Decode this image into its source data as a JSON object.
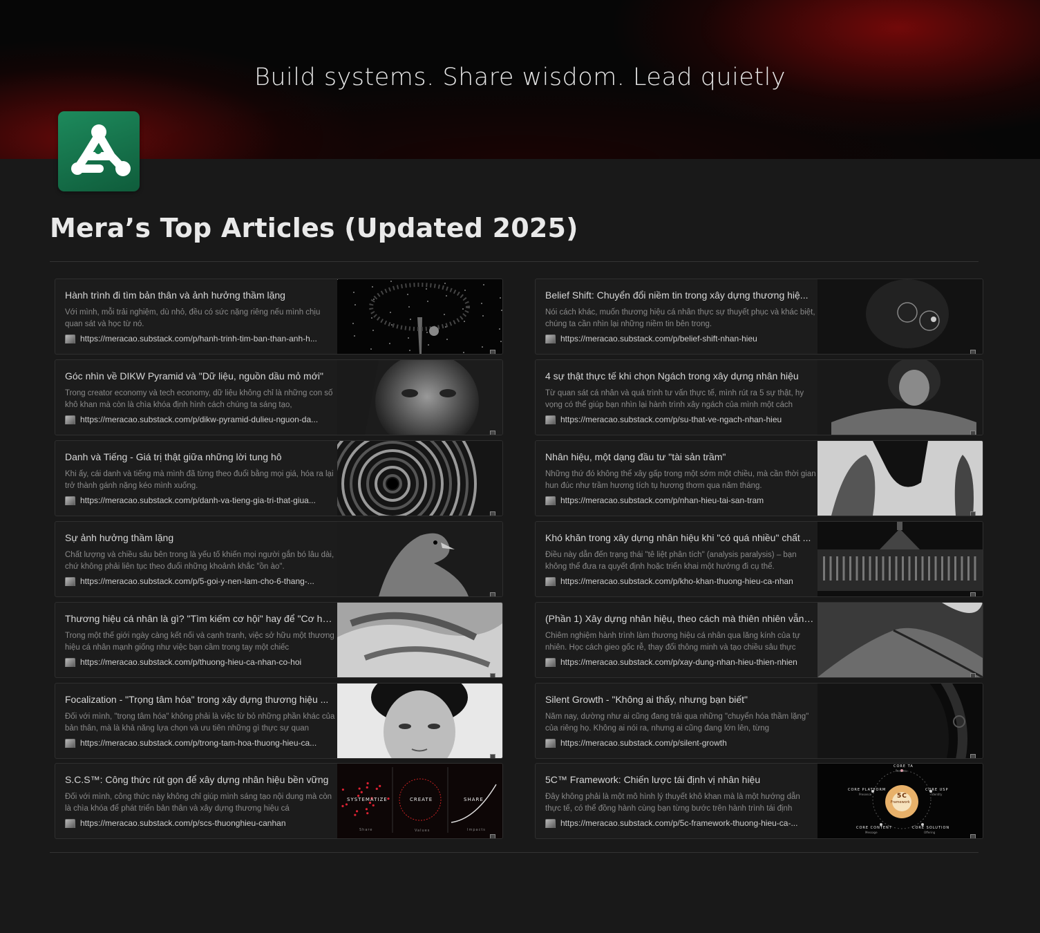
{
  "cover": {
    "tagline": "Build systems. Share wisdom. Lead quietly"
  },
  "page": {
    "title": "Mera’s Top Articles (Updated 2025)"
  },
  "colors": {
    "background": "#191919",
    "card_border": "#2f2f2f",
    "icon_green": "#1d8a5c",
    "cover_red": "#960a0a"
  },
  "left_cards": [
    {
      "title": "Hành trình đi tìm bản thân và ảnh hưởng thầm lặng",
      "desc": "Với mình, mỗi trải nghiệm, dù nhỏ, đều có sức nặng riêng nếu mình chịu quan sát và học từ nó.",
      "url": "https://meracao.substack.com/p/hanh-trinh-tim-ban-than-anh-h...",
      "thumb": "tree-night-thumbnail"
    },
    {
      "title": "Góc nhìn về DIKW Pyramid và \"Dữ liệu, nguồn dầu mỏ mới\"",
      "desc": "Trong creator economy và tech economy, dữ liệu không chỉ là những con số khô khan mà còn là chìa khóa định hình cách chúng ta sáng tạo,",
      "url": "https://meracao.substack.com/p/dikw-pyramid-dulieu-nguon-da...",
      "thumb": "face-portrait-thumbnail"
    },
    {
      "title": "Danh và Tiếng - Giá trị thật giữa những lời tung hô",
      "desc": "Khi ấy, cái danh và tiếng mà mình đã từng theo đuổi bằng mọi giá, hóa ra lại trở thành gánh nặng kéo mình xuống.",
      "url": "https://meracao.substack.com/p/danh-va-tieng-gia-tri-that-giua...",
      "thumb": "spiral-stair-thumbnail"
    },
    {
      "title": "Sự ảnh hưởng thầm lặng",
      "desc": "Chất lượng và chiều sâu bên trong là yếu tố khiến mọi người gắn bó lâu dài, chứ không phải liên tục theo đuổi những khoảnh khắc \"ồn ào\".",
      "url": "https://meracao.substack.com/p/5-goi-y-nen-lam-cho-6-thang-...",
      "thumb": "eagle-thumbnail"
    },
    {
      "title": "Thương hiệu cá nhân là gì? \"Tìm kiếm cơ hội\" hay để \"Cơ hội...",
      "desc": "Trong một thế giới ngày càng kết nối và cạnh tranh, việc sở hữu một thương hiệu cá nhân mạnh giống như việc bạn cầm trong tay một chiếc",
      "url": "https://meracao.substack.com/p/thuong-hieu-ca-nhan-co-hoi",
      "thumb": "hands-thumbnail"
    },
    {
      "title": "Focalization - \"Trọng tâm hóa\" trong xây dựng thương hiệu ...",
      "desc": "Đối với mình, \"trọng tâm hóa\" không phải là việc từ bỏ những phần khác của bản thân, mà là khả năng lựa chọn và ưu tiên những gì thực sự quan",
      "url": "https://meracao.substack.com/p/trong-tam-hoa-thuong-hieu-ca...",
      "thumb": "boy-portrait-thumbnail"
    },
    {
      "title": "S.C.S™: Công thức rút gọn để xây dựng nhân hiệu bền vững",
      "desc": "Đối với mình, công thức này không chỉ giúp mình sáng tạo nội dung mà còn là chìa khóa để phát triển bản thân và xây dựng thương hiệu cá",
      "url": "https://meracao.substack.com/p/scs-thuonghieu-canhan",
      "thumb": "scs-diagram-thumbnail"
    }
  ],
  "right_cards": [
    {
      "title": "Belief Shift: Chuyển đổi niềm tin trong xây dựng thương hiệ...",
      "desc": "Nói cách khác, muốn thương hiệu cá nhân thực sự thuyết phục và khác biệt, chúng ta cần nhìn lại những niềm tin bên trong.",
      "url": "https://meracao.substack.com/p/belief-shift-nhan-hieu",
      "thumb": "glasses-thumbnail"
    },
    {
      "title": "4 sự thật thực tế khi chọn Ngách trong xây dựng nhân hiệu",
      "desc": "Từ quan sát cá nhân và quá trình tư vấn thực tế, mình rút ra 5 sự thật, hy vọng có thể giúp bạn nhìn lại hành trình xây ngách của mình một cách",
      "url": "https://meracao.substack.com/p/su-that-ve-ngach-nhan-hieu",
      "thumb": "reading-woman-thumbnail"
    },
    {
      "title": "Nhân hiệu, một dạng đầu tư \"tài sản trầm\"",
      "desc": "Những thứ đó không thể xây gấp trong một sớm một chiều, mà cần thời gian hun đúc như trầm hương tích tụ hương thơm qua năm tháng.",
      "url": "https://meracao.substack.com/p/nhan-hieu-tai-san-tram",
      "thumb": "figures-thumbnail"
    },
    {
      "title": "Khó khăn trong xây dựng nhân hiệu khi \"có quá nhiều\" chất ...",
      "desc": "Điều này dẫn đến trạng thái \"tê liệt phân tích\" (analysis paralysis) – bạn không thể đưa ra quyết định hoặc triển khai một hướng đi cụ thể.",
      "url": "https://meracao.substack.com/p/kho-khan-thuong-hieu-ca-nhan",
      "thumb": "palace-thumbnail"
    },
    {
      "title": "(Phần 1) Xây dựng nhân hiệu, theo cách mà thiên nhiên vẫn l...",
      "desc": "Chiêm nghiệm hành trình làm thương hiệu cá nhân qua lăng kính của tự nhiên. Học cách gieo gốc rễ, thay đổi thông minh và tạo chiều sâu thực",
      "url": "https://meracao.substack.com/p/xay-dung-nhan-hieu-thien-nhien",
      "thumb": "dune-thumbnail"
    },
    {
      "title": "Silent Growth - \"Không ai thấy, nhưng bạn biết\"",
      "desc": "Năm nay, dường như ai cũng đang trải qua những \"chuyển hóa thầm lặng\" của riêng họ. Không ai nói ra, nhưng ai cũng đang lớn lên, từng",
      "url": "https://meracao.substack.com/p/silent-growth",
      "thumb": "clock-thumbnail"
    },
    {
      "title": "5C™ Framework: Chiến lược tái định vị nhân hiệu",
      "desc": "Đây không phải là một mô hình lý thuyết khô khan mà là một hướng dẫn thực tế, có thể đồng hành cùng bạn từng bước trên hành trình tái định",
      "url": "https://meracao.substack.com/p/5c-framework-thuong-hieu-ca-...",
      "thumb": "5c-diagram-thumbnail"
    }
  ],
  "scs_diagram": {
    "labels": [
      "SYSTEMATIZE",
      "CREATE",
      "SHARE"
    ],
    "sublabels": [
      "Share",
      "Values",
      "Impacts"
    ]
  },
  "fivec_diagram": {
    "center": "5C",
    "center_sub": "Framework",
    "labels": [
      "CORE TA",
      "CORE PLATFORM",
      "CORE USP",
      "CORE CONTENT",
      "CORE SOLUTION"
    ],
    "sublabels": [
      "Persona",
      "Presence",
      "Identity",
      "Message",
      "Offering"
    ]
  }
}
